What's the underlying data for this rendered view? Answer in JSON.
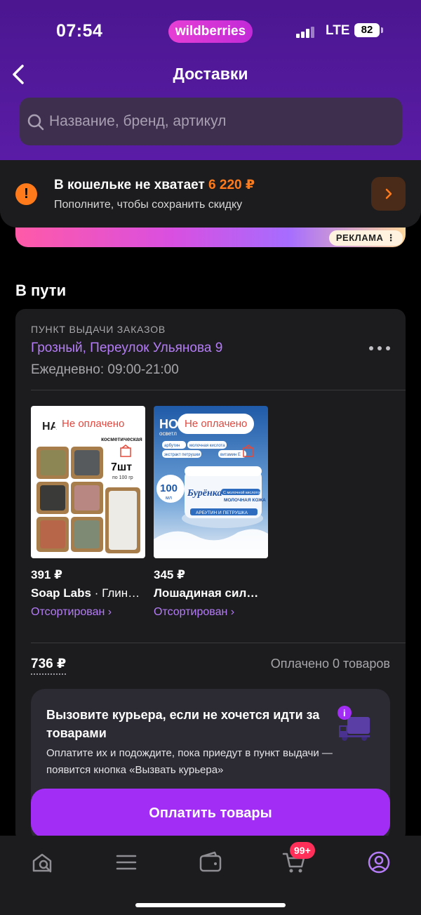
{
  "status_bar": {
    "time": "07:54",
    "carrier": "LTE",
    "battery": "82",
    "brand_logo": "wildberries"
  },
  "header": {
    "title": "Доставки",
    "back_icon": "chevron-left-icon"
  },
  "search": {
    "placeholder": "Название, бренд, артикул"
  },
  "wallet_banner": {
    "title": "В кошельке не хватает",
    "amount": "6 220 ₽",
    "subtitle": "Пополните, чтобы сохранить скидку",
    "accent": "#ff7a1a"
  },
  "ad": {
    "badge": "РЕКЛАМА ⋮"
  },
  "section": {
    "title": "В пути"
  },
  "pickup": {
    "label": "ПУНКТ ВЫДАЧИ ЗАКАЗОВ",
    "address": "Грозный, Переулок Ульянова 9",
    "hours": "Ежедневно: 09:00-21:00"
  },
  "products": [
    {
      "badge": "Не оплачено",
      "price": "391 ₽",
      "brand": "Soap Labs",
      "name": " · Глин…",
      "status": "Отсортирован ›",
      "image_text": {
        "top": "НА",
        "sub": "косметическая",
        "count": "7шт",
        "per": "по 100 гр"
      }
    },
    {
      "badge": "Не оплачено",
      "price": "345 ₽",
      "brand": "Лошадиная сил…",
      "name": "",
      "status": "Отсортирован ›",
      "image_text": {
        "top": "НО",
        "sub": "осветл",
        "ml": "100",
        "ml_unit": "мл",
        "brand_mark": "Бурёнка",
        "tags": [
          "арбутин",
          "молочная кислота",
          "экстракт петрушки",
          "витамин Е"
        ],
        "label1": "С молочной кислотой",
        "label2": "МОЛОЧНАЯ КОЖА",
        "label3": "АРБУТИН И ПЕТРУШКА"
      }
    }
  ],
  "summary": {
    "total": "736 ₽",
    "paid": "Оплачено 0 товаров"
  },
  "courier": {
    "title": "Вызовите курьера, если не хочется идти за товарами",
    "text": "Оплатите их и подождите, пока приедут в пункт выдачи — появится кнопка «Вызвать курьера»",
    "button": "Оплатить товары"
  },
  "tabbar": {
    "cart_badge": "99+",
    "icons": [
      "home-search-icon",
      "menu-icon",
      "wallet-icon",
      "cart-icon",
      "profile-icon"
    ]
  },
  "colors": {
    "accent": "#a22ef5",
    "link": "#b57cf8",
    "danger": "#e0483f"
  }
}
